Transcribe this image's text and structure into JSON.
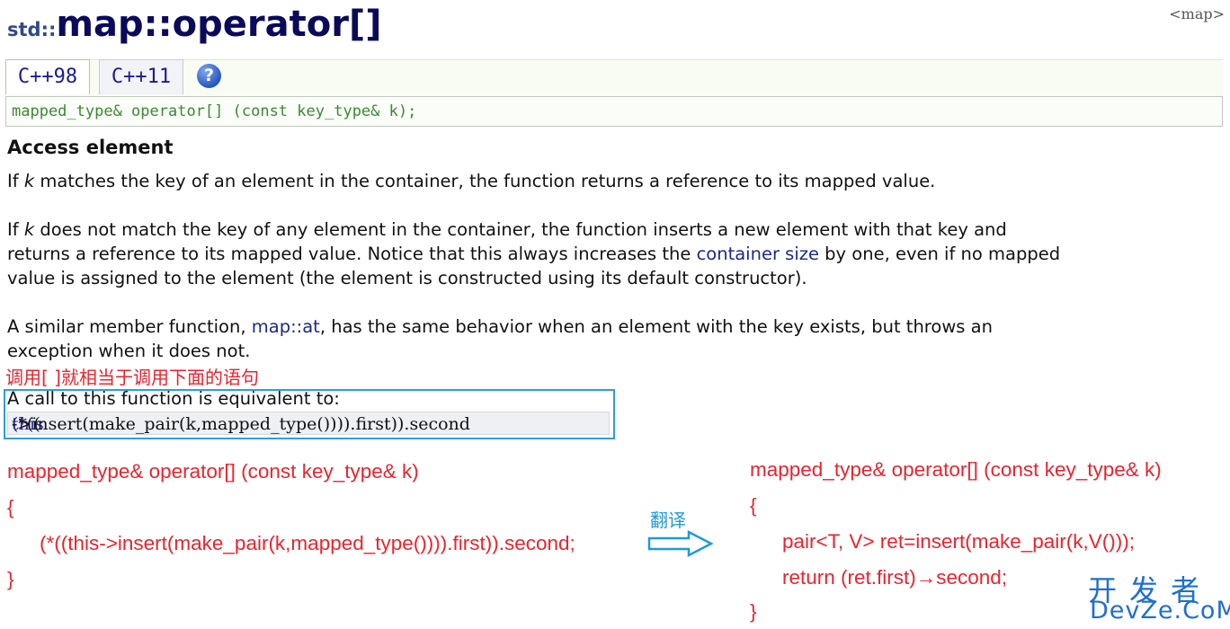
{
  "header": {
    "namespace": "std::",
    "title": "map::operator[]",
    "header_link": "<map>"
  },
  "tabs": [
    {
      "label": "C++98"
    },
    {
      "label": "C++11"
    }
  ],
  "help_icon_glyph": "?",
  "declaration": "mapped_type& operator[] (const key_type& k);",
  "section_heading": "Access element",
  "paragraphs": {
    "p1_pre": "If ",
    "p1_k": "k",
    "p1_post": " matches the key of an element in the container, the function returns a reference to its mapped value.",
    "p2_l1_pre": "If ",
    "p2_l1_k": "k",
    "p2_l1_post": " does not match the key of any element in the container, the function inserts a new element with that key and",
    "p2_l2_pre": "returns a reference to its mapped value. Notice that this always increases the ",
    "p2_l2_link": "container size",
    "p2_l2_post": " by one, even if no mapped",
    "p2_l3": "value is assigned to the element (the element is constructed using its default constructor).",
    "p3_l1_pre": "A similar member function, ",
    "p3_l1_link": "map::at",
    "p3_l1_post": ", has the same behavior when an element with the key exists, but throws an",
    "p3_l2": "exception when it does not."
  },
  "annotation_note": "调用[ ]就相当于调用下面的语句",
  "equivalent": {
    "text": "A call to this function is equivalent to:",
    "code_pre": "(*((",
    "code_kw": "this",
    "code_post": "->insert(make_pair(k,mapped_type()))).first)).second"
  },
  "left_code": {
    "sig": "mapped_type& operator[] (const key_type& k)",
    "open": "{",
    "body": "(*((this->insert(make_pair(k,mapped_type()))).first)).second;",
    "close": "}"
  },
  "translate_label": "翻译",
  "right_code": {
    "sig": "mapped_type& operator[] (const key_type& k)",
    "open": "{",
    "line1": "pair<T, V> ret=insert(make_pair(k,V()));",
    "line2": "return  (ret.first)→second;",
    "close": "}"
  },
  "watermark": {
    "top": "开发者",
    "bottom": "DevZe.CoM"
  },
  "colors": {
    "title": "#0a0a5c",
    "annotation_red": "#e8242e",
    "annotation_blue": "#2aa0d9",
    "link": "#1b2a8c",
    "declaration_green": "#3a8a30"
  }
}
